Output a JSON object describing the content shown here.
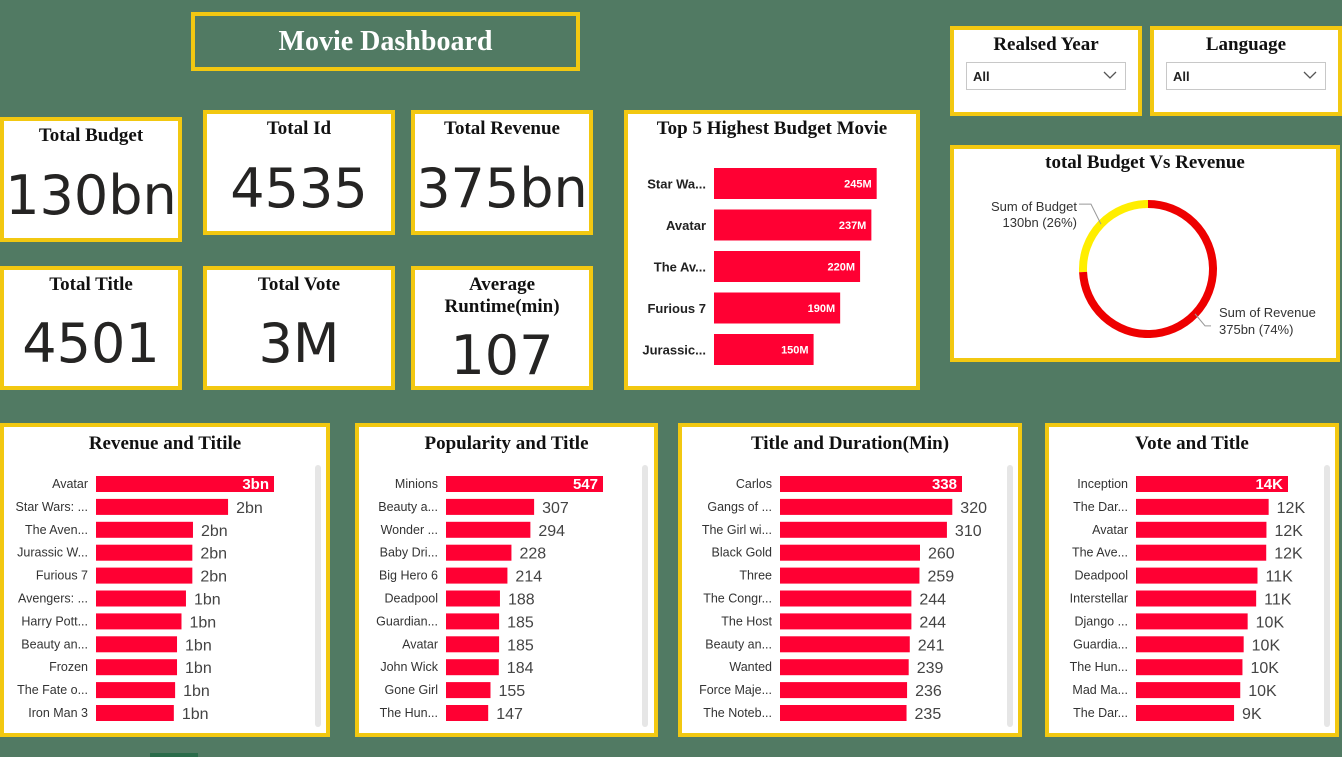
{
  "header": {
    "title": "Movie Dashboard"
  },
  "kpis": {
    "total_budget": {
      "label": "Total Budget",
      "value": "130bn"
    },
    "total_id": {
      "label": "Total Id",
      "value": "4535"
    },
    "total_revenue": {
      "label": "Total Revenue",
      "value": "375bn"
    },
    "total_title": {
      "label": "Total Title",
      "value": "4501"
    },
    "total_vote": {
      "label": "Total Vote",
      "value": "3M"
    },
    "avg_runtime": {
      "label": "Average Runtime(min)",
      "value": "107"
    }
  },
  "filters": {
    "year": {
      "label": "Realsed Year",
      "value": "All"
    },
    "language": {
      "label": "Language",
      "value": "All"
    }
  },
  "colors": {
    "bar": "#ff0033",
    "budget_slice": "#ffee00",
    "revenue_slice": "#ee0000",
    "border": "#f2c811",
    "background": "#517a63"
  },
  "chart_data": [
    {
      "id": "top5",
      "type": "bar",
      "orientation": "horizontal",
      "title": "Top 5 Highest Budget Movie",
      "categories": [
        "Star Wa...",
        "Avatar",
        "The Av...",
        "Furious 7",
        "Jurassic..."
      ],
      "values": [
        245,
        237,
        220,
        190,
        150
      ],
      "value_labels": [
        "245M",
        "237M",
        "220M",
        "190M",
        "150M"
      ],
      "unit": "M",
      "xlim": [
        0,
        250
      ]
    },
    {
      "id": "donut",
      "type": "pie",
      "title": "total Budget Vs Revenue",
      "slices": [
        {
          "name": "Sum of Budget",
          "value": 130,
          "label": "130bn (26%)",
          "percent": 26
        },
        {
          "name": "Sum of Revenue",
          "value": 375,
          "label": "375bn (74%)",
          "percent": 74
        }
      ]
    },
    {
      "id": "revenue",
      "type": "bar",
      "orientation": "horizontal",
      "title": "Revenue and Titile",
      "categories": [
        "Avatar",
        "Star Wars: ...",
        "The Aven...",
        "Jurassic W...",
        "Furious 7",
        "Avengers: ...",
        "Harry Pott...",
        "Beauty an...",
        "Frozen",
        "The Fate o...",
        "Iron Man 3"
      ],
      "values": [
        2.79,
        2.07,
        1.52,
        1.51,
        1.51,
        1.41,
        1.34,
        1.27,
        1.27,
        1.24,
        1.22
      ],
      "value_labels": [
        "3bn",
        "2bn",
        "2bn",
        "2bn",
        "2bn",
        "1bn",
        "1bn",
        "1bn",
        "1bn",
        "1bn",
        "1bn"
      ],
      "unit": "bn"
    },
    {
      "id": "popularity",
      "type": "bar",
      "orientation": "horizontal",
      "title": "Popularity and Title",
      "categories": [
        "Minions",
        "Beauty a...",
        "Wonder ...",
        "Baby Dri...",
        "Big Hero 6",
        "Deadpool",
        "Guardian...",
        "Avatar",
        "John Wick",
        "Gone Girl",
        "The Hun..."
      ],
      "values": [
        547,
        307,
        294,
        228,
        214,
        188,
        185,
        185,
        184,
        155,
        147
      ],
      "value_labels": [
        "547",
        "307",
        "294",
        "228",
        "214",
        "188",
        "185",
        "185",
        "184",
        "155",
        "147"
      ]
    },
    {
      "id": "duration",
      "type": "bar",
      "orientation": "horizontal",
      "title": "Title and Duration(Min)",
      "categories": [
        "Carlos",
        "Gangs of ...",
        "The Girl wi...",
        "Black Gold",
        "Three",
        "The Congr...",
        "The Host",
        "Beauty an...",
        "Wanted",
        "Force Maje...",
        "The Noteb..."
      ],
      "values": [
        338,
        320,
        310,
        260,
        259,
        244,
        244,
        241,
        239,
        236,
        235
      ],
      "value_labels": [
        "338",
        "320",
        "310",
        "260",
        "259",
        "244",
        "244",
        "241",
        "239",
        "236",
        "235"
      ]
    },
    {
      "id": "vote",
      "type": "bar",
      "orientation": "horizontal",
      "title": "Vote and Title",
      "categories": [
        "Inception",
        "The Dar...",
        "Avatar",
        "The Ave...",
        "Deadpool",
        "Interstellar",
        "Django ...",
        "Guardia...",
        "The Hun...",
        "Mad Ma...",
        "The Dar..."
      ],
      "values": [
        13.75,
        12.0,
        11.8,
        11.78,
        10.99,
        10.87,
        10.1,
        9.74,
        9.63,
        9.43,
        8.87
      ],
      "value_labels": [
        "14K",
        "12K",
        "12K",
        "12K",
        "11K",
        "11K",
        "10K",
        "10K",
        "10K",
        "10K",
        "9K"
      ],
      "unit": "K"
    }
  ]
}
